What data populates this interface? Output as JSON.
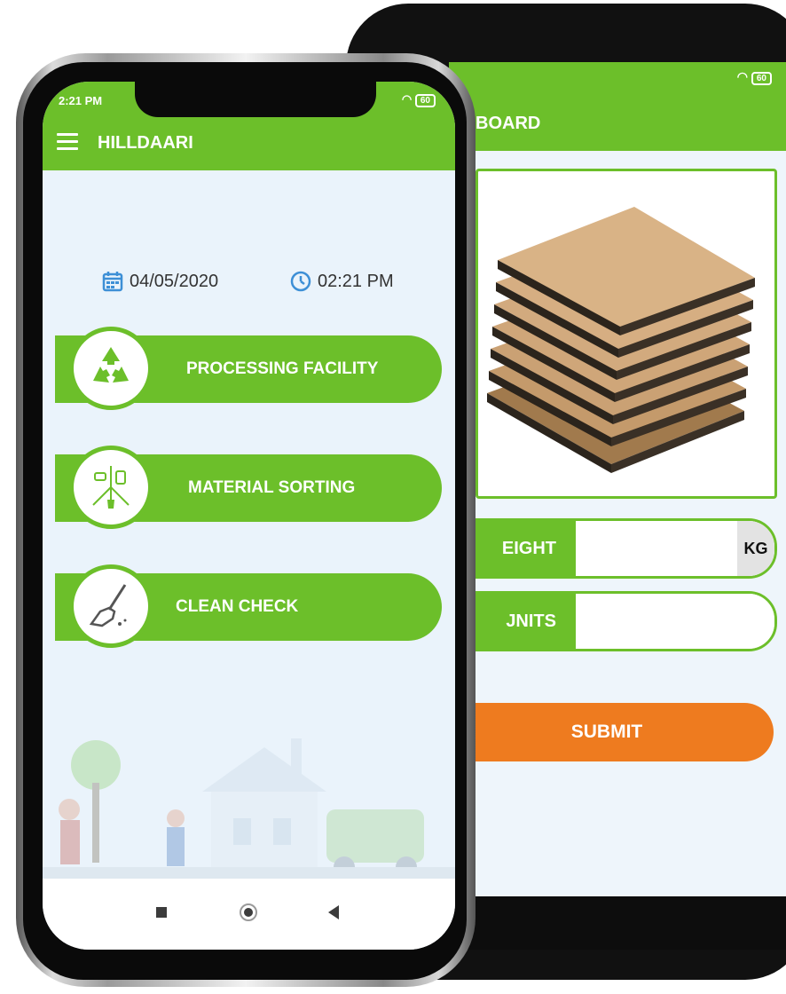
{
  "colors": {
    "accent": "#6cbf2a",
    "submit": "#ee7b1f",
    "icon_blue": "#3d8fd6"
  },
  "front": {
    "status": {
      "time": "2:21 PM",
      "battery": "60"
    },
    "appbar": {
      "title": "HILLDAARI"
    },
    "date": "04/05/2020",
    "time": "02:21 PM",
    "menu": [
      {
        "label": "PROCESSING FACILITY",
        "icon": "recycle-icon"
      },
      {
        "label": "MATERIAL SORTING",
        "icon": "sorting-icon"
      },
      {
        "label": "CLEAN CHECK",
        "icon": "broom-icon"
      }
    ]
  },
  "back": {
    "status": {
      "battery": "60"
    },
    "appbar": {
      "title": "BOARD"
    },
    "image": "cardboard-sheets",
    "weight": {
      "label": "EIGHT",
      "value": "",
      "unit": "KG"
    },
    "units": {
      "label": "JNITS",
      "value": ""
    },
    "submit_label": "SUBMIT"
  }
}
